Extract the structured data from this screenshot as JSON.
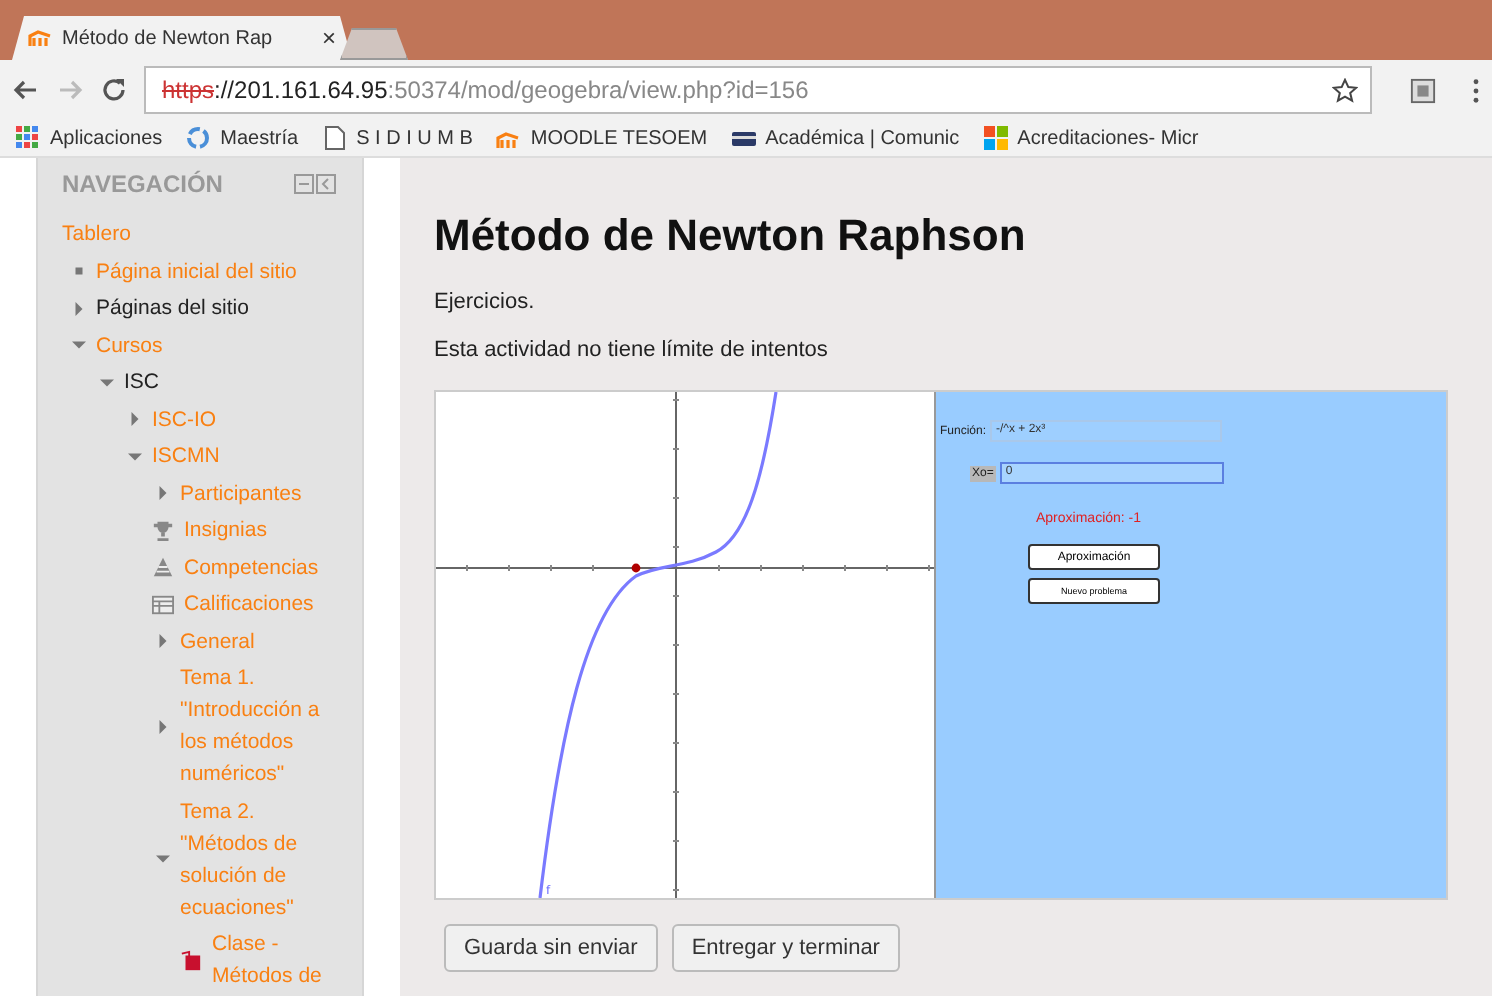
{
  "browser": {
    "tabs": [
      {
        "title": "Método de Newton Rap",
        "close": "×",
        "selected": true
      },
      {
        "selected": false
      }
    ],
    "address": {
      "scheme": "https",
      "host": "://201.161.64.95",
      "path": ":50374/mod/geogebra/view.php?id=156"
    },
    "bookmarks": [
      {
        "kind": "apps",
        "label": "Aplicaciones"
      },
      {
        "kind": "recycle",
        "label": "Maestría"
      },
      {
        "kind": "page",
        "label": "S I D I U M B"
      },
      {
        "kind": "moodle",
        "label": "MOODLE TESOEM"
      },
      {
        "kind": "card",
        "label": "Académica | Comunic"
      },
      {
        "kind": "windows",
        "label": "Acreditaciones- Micr"
      }
    ]
  },
  "sidebar": {
    "title": "NAVEGACIÓN",
    "items": [
      {
        "label": "Tablero",
        "link": true,
        "children": [
          {
            "kind": "leaf",
            "label": "Página inicial del sitio",
            "link": true
          },
          {
            "kind": "node",
            "label": "Páginas del sitio",
            "link": false,
            "expanded": false
          },
          {
            "kind": "node",
            "label": "Cursos",
            "link": true,
            "expanded": true,
            "children": [
              {
                "kind": "node",
                "label": "ISC",
                "link": false,
                "expanded": true,
                "children": [
                  {
                    "kind": "node",
                    "label": "ISC-IO",
                    "link": true,
                    "expanded": false
                  },
                  {
                    "kind": "node",
                    "label": "ISCMN",
                    "link": true,
                    "expanded": true,
                    "children": [
                      {
                        "kind": "node",
                        "label": "Participantes",
                        "link": true,
                        "expanded": false
                      },
                      {
                        "kind": "badges",
                        "label": "Insignias",
                        "link": true
                      },
                      {
                        "kind": "competencies",
                        "label": "Competencias",
                        "link": true
                      },
                      {
                        "kind": "grades",
                        "label": "Calificaciones",
                        "link": true
                      },
                      {
                        "kind": "node",
                        "label": "General",
                        "link": true,
                        "expanded": false
                      },
                      {
                        "kind": "node",
                        "label": "Tema 1.\n\"Introducción a\nlos métodos\nnuméricos\"",
                        "link": true,
                        "expanded": false
                      },
                      {
                        "kind": "node",
                        "label": "Tema 2.\n\"Métodos de\nsolución de\necuaciones\"",
                        "link": true,
                        "expanded": true,
                        "children": [
                          {
                            "kind": "activity",
                            "label": "Clase -\nMétodos de",
                            "link": true
                          }
                        ]
                      }
                    ]
                  }
                ]
              }
            ]
          }
        ]
      }
    ]
  },
  "main": {
    "title": "Método de Newton Raphson",
    "intro": "Ejercicios.",
    "attempts": "Esta actividad no tiene límite de intentos",
    "applet": {
      "curve_label": "f",
      "function_label": "Función:",
      "function_value": "-/^x + 2x³",
      "x0_label": "Xo=",
      "x0_value": "0",
      "result": "Aproximación: -1",
      "buttons": [
        "Aproximación",
        "Nuevo problema"
      ]
    },
    "buttons": [
      "Guarda sin enviar",
      "Entregar y terminar"
    ]
  }
}
